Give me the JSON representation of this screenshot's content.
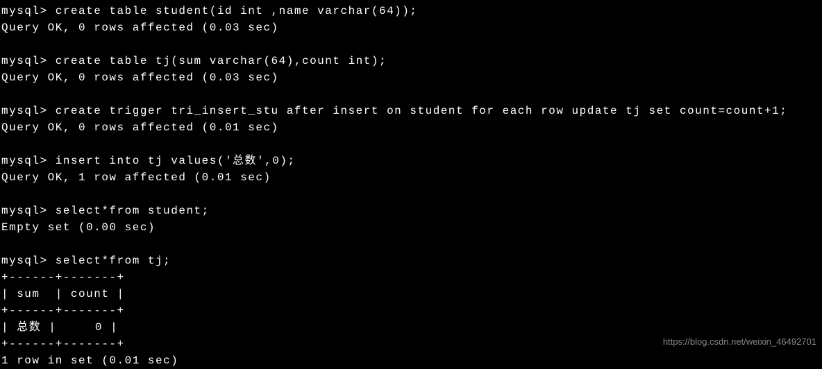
{
  "terminal": {
    "lines": [
      "mysql> create table student(id int ,name varchar(64));",
      "Query OK, 0 rows affected (0.03 sec)",
      "",
      "mysql> create table tj(sum varchar(64),count int);",
      "Query OK, 0 rows affected (0.03 sec)",
      "",
      "mysql> create trigger tri_insert_stu after insert on student for each row update tj set count=count+1;",
      "Query OK, 0 rows affected (0.01 sec)",
      "",
      "mysql> insert into tj values('总数',0);",
      "Query OK, 1 row affected (0.01 sec)",
      "",
      "mysql> select*from student;",
      "Empty set (0.00 sec)",
      "",
      "mysql> select*from tj;",
      "+------+-------+",
      "| sum  | count |",
      "+------+-------+",
      "| 总数 |     0 |",
      "+------+-------+",
      "1 row in set (0.01 sec)"
    ]
  },
  "watermark": "https://blog.csdn.net/weixin_46492701"
}
